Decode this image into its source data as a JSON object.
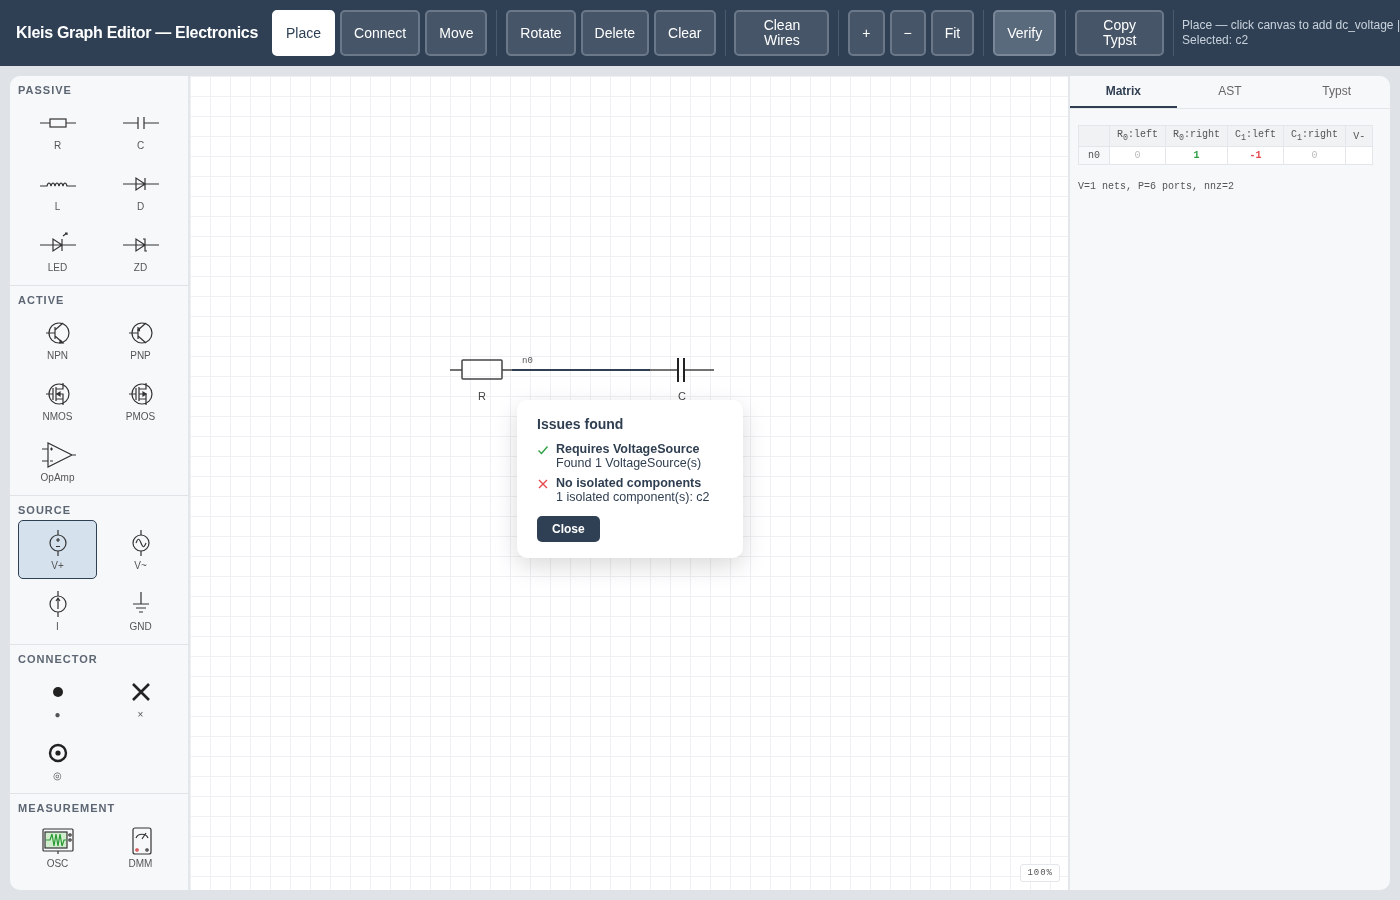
{
  "app": {
    "title": "Kleis Graph Editor — Electronics"
  },
  "toolbar": [
    {
      "buttons": [
        {
          "label": "Place",
          "selected": true,
          "kind": "plain"
        },
        {
          "label": "Connect",
          "selected": false,
          "kind": "plain"
        },
        {
          "label": "Move",
          "selected": false,
          "kind": "plain"
        }
      ]
    },
    {
      "buttons": [
        {
          "label": "Rotate",
          "selected": false,
          "kind": "plain"
        },
        {
          "label": "Delete",
          "selected": false,
          "kind": "plain"
        },
        {
          "label": "Clear",
          "selected": false,
          "kind": "plain"
        }
      ]
    },
    {
      "buttons": [
        {
          "label": "Clean Wires",
          "selected": false,
          "kind": "plain"
        }
      ]
    },
    {
      "buttons": [
        {
          "label": "+",
          "selected": false,
          "kind": "plain"
        },
        {
          "label": "−",
          "selected": false,
          "kind": "plain"
        },
        {
          "label": "Fit",
          "selected": false,
          "kind": "plain"
        }
      ]
    },
    {
      "buttons": [
        {
          "label": "Verify",
          "selected": false,
          "kind": "accent"
        }
      ]
    },
    {
      "buttons": [
        {
          "label": "Copy Typst",
          "selected": false,
          "kind": "plain"
        }
      ]
    }
  ],
  "status_lines": [
    "Place — click canvas to add dc_voltage |",
    "Selected: c2"
  ],
  "palette": [
    {
      "title": "PASSIVE",
      "items": [
        {
          "label": "R",
          "kind": "resistor",
          "selected": false
        },
        {
          "label": "C",
          "kind": "capacitor",
          "selected": false
        },
        {
          "label": "L",
          "kind": "inductor",
          "selected": false
        },
        {
          "label": "D",
          "kind": "diode",
          "selected": false
        },
        {
          "label": "LED",
          "kind": "led",
          "selected": false
        },
        {
          "label": "ZD",
          "kind": "zener",
          "selected": false
        }
      ]
    },
    {
      "title": "ACTIVE",
      "items": [
        {
          "label": "NPN",
          "kind": "npn",
          "selected": false
        },
        {
          "label": "PNP",
          "kind": "pnp",
          "selected": false
        },
        {
          "label": "NMOS",
          "kind": "nmos",
          "selected": false
        },
        {
          "label": "PMOS",
          "kind": "pmos",
          "selected": false
        },
        {
          "label": "OpAmp",
          "kind": "opamp",
          "selected": false
        }
      ]
    },
    {
      "title": "SOURCE",
      "items": [
        {
          "label": "V+",
          "kind": "dc_voltage",
          "selected": true
        },
        {
          "label": "V~",
          "kind": "ac_voltage",
          "selected": false
        },
        {
          "label": "I",
          "kind": "current",
          "selected": false
        },
        {
          "label": "GND",
          "kind": "ground",
          "selected": false
        }
      ]
    },
    {
      "title": "CONNECTOR",
      "items": [
        {
          "label": "●",
          "kind": "junction",
          "selected": false
        },
        {
          "label": "×",
          "kind": "cross",
          "selected": false
        },
        {
          "label": "◎",
          "kind": "terminal",
          "selected": false
        }
      ]
    },
    {
      "title": "MEASUREMENT",
      "items": [
        {
          "label": "OSC",
          "kind": "oscilloscope",
          "selected": false
        },
        {
          "label": "DMM",
          "kind": "multimeter",
          "selected": false
        }
      ]
    }
  ],
  "canvas": {
    "components": [
      {
        "label": "R",
        "kind": "resistor"
      },
      {
        "label": "C",
        "kind": "capacitor"
      }
    ],
    "net_label": "n0",
    "zoom": "100%"
  },
  "dialog": {
    "title": "Issues found",
    "checks": [
      {
        "passed": true,
        "title": "Requires VoltageSource",
        "detail": "Found 1 VoltageSource(s)"
      },
      {
        "passed": false,
        "title": "No isolated components",
        "detail": "1 isolated component(s): c2"
      }
    ],
    "button": "Close"
  },
  "panel": {
    "tabs": [
      {
        "label": "Matrix",
        "selected": true
      },
      {
        "label": "AST",
        "selected": false
      },
      {
        "label": "Typst",
        "selected": false
      }
    ],
    "matrix": {
      "columns": [
        "R$_{0}$:left",
        "R$_{0}$:right",
        "C$_{1}$:left",
        "C$_{1}$:right",
        "V-"
      ],
      "rows": [
        {
          "label": "n0",
          "cells": [
            {
              "text": "0",
              "kind": "zero"
            },
            {
              "text": "1",
              "kind": "positive"
            },
            {
              "text": "-1",
              "kind": "negative"
            },
            {
              "text": "0",
              "kind": "zero"
            }
          ]
        }
      ]
    },
    "summary": "V=1 nets, P=6 ports, nnz=2"
  }
}
